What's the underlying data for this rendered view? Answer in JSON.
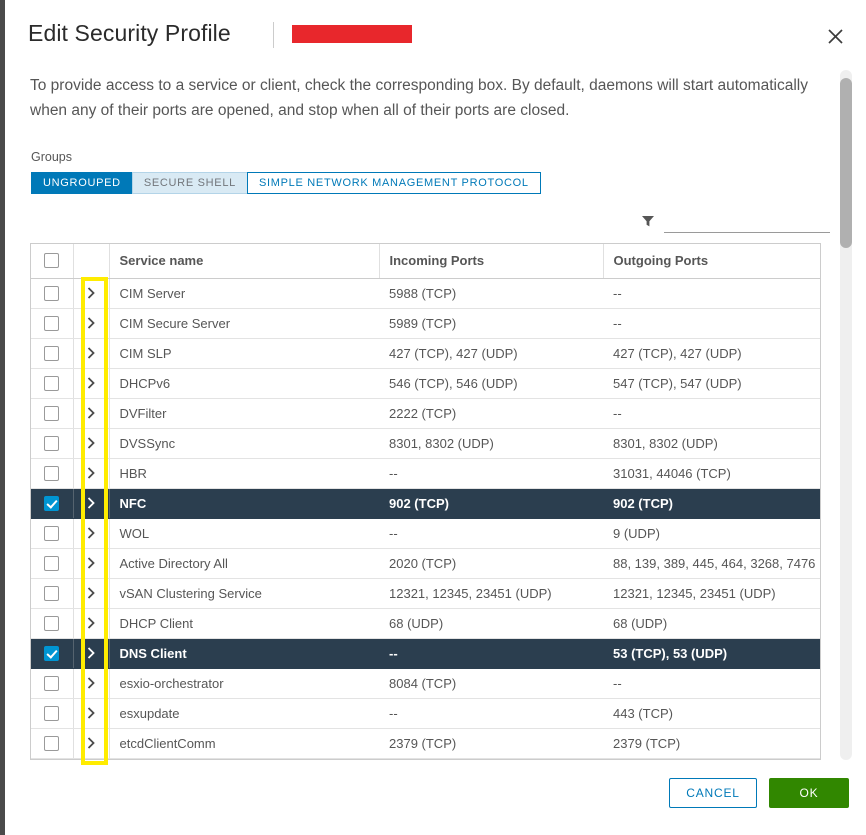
{
  "dialog": {
    "title": "Edit Security Profile",
    "subtitle_redacted": true,
    "close_icon": "close-icon",
    "description": "To provide access to a service or client, check the corresponding box. By default, daemons will start automatically when any of their ports are opened, and stop when all of their ports are closed."
  },
  "groups": {
    "label": "Groups",
    "tabs": [
      {
        "label": "UNGROUPED",
        "state": "active"
      },
      {
        "label": "SECURE SHELL",
        "state": "hovered"
      },
      {
        "label": "SIMPLE NETWORK MANAGEMENT PROTOCOL",
        "state": "default"
      }
    ]
  },
  "filter": {
    "icon": "filter-icon",
    "value": "",
    "placeholder": ""
  },
  "table": {
    "select_all_checked": false,
    "columns": [
      "",
      "",
      "Service name",
      "Incoming Ports",
      "Outgoing Ports"
    ],
    "rows": [
      {
        "checked": false,
        "name": "CIM Server",
        "incoming": "5988 (TCP)",
        "outgoing": "--"
      },
      {
        "checked": false,
        "name": "CIM Secure Server",
        "incoming": "5989 (TCP)",
        "outgoing": "--"
      },
      {
        "checked": false,
        "name": "CIM SLP",
        "incoming": "427 (TCP), 427 (UDP)",
        "outgoing": "427 (TCP), 427 (UDP)"
      },
      {
        "checked": false,
        "name": "DHCPv6",
        "incoming": "546 (TCP), 546 (UDP)",
        "outgoing": "547 (TCP), 547 (UDP)"
      },
      {
        "checked": false,
        "name": "DVFilter",
        "incoming": "2222 (TCP)",
        "outgoing": "--"
      },
      {
        "checked": false,
        "name": "DVSSync",
        "incoming": "8301, 8302 (UDP)",
        "outgoing": "8301, 8302 (UDP)"
      },
      {
        "checked": false,
        "name": "HBR",
        "incoming": "--",
        "outgoing": "31031, 44046 (TCP)"
      },
      {
        "checked": true,
        "name": "NFC",
        "incoming": "902 (TCP)",
        "outgoing": "902 (TCP)"
      },
      {
        "checked": false,
        "name": "WOL",
        "incoming": "--",
        "outgoing": "9 (UDP)"
      },
      {
        "checked": false,
        "name": "Active Directory All",
        "incoming": "2020 (TCP)",
        "outgoing": "88, 139, 389, 445, 464, 3268, 7476"
      },
      {
        "checked": false,
        "name": "vSAN Clustering Service",
        "incoming": "12321, 12345, 23451 (UDP)",
        "outgoing": "12321, 12345, 23451 (UDP)"
      },
      {
        "checked": false,
        "name": "DHCP Client",
        "incoming": "68 (UDP)",
        "outgoing": "68 (UDP)"
      },
      {
        "checked": true,
        "name": "DNS Client",
        "incoming": "--",
        "outgoing": "53 (TCP), 53 (UDP)"
      },
      {
        "checked": false,
        "name": "esxio-orchestrator",
        "incoming": "8084 (TCP)",
        "outgoing": "--"
      },
      {
        "checked": false,
        "name": "esxupdate",
        "incoming": "--",
        "outgoing": "443 (TCP)"
      },
      {
        "checked": false,
        "name": "etcdClientComm",
        "incoming": "2379 (TCP)",
        "outgoing": "2379 (TCP)"
      }
    ]
  },
  "footer": {
    "cancel_label": "CANCEL",
    "ok_label": "OK"
  },
  "annotation": {
    "type": "highlight-box",
    "color": "#ffec00",
    "target": "expand-column"
  },
  "colors": {
    "accent_blue": "#0079b8",
    "checkbox_blue": "#0095d3",
    "selected_row": "#2b3e4f",
    "ok_green": "#318700",
    "redaction_red": "#e8272c",
    "highlight_yellow": "#ffec00"
  }
}
